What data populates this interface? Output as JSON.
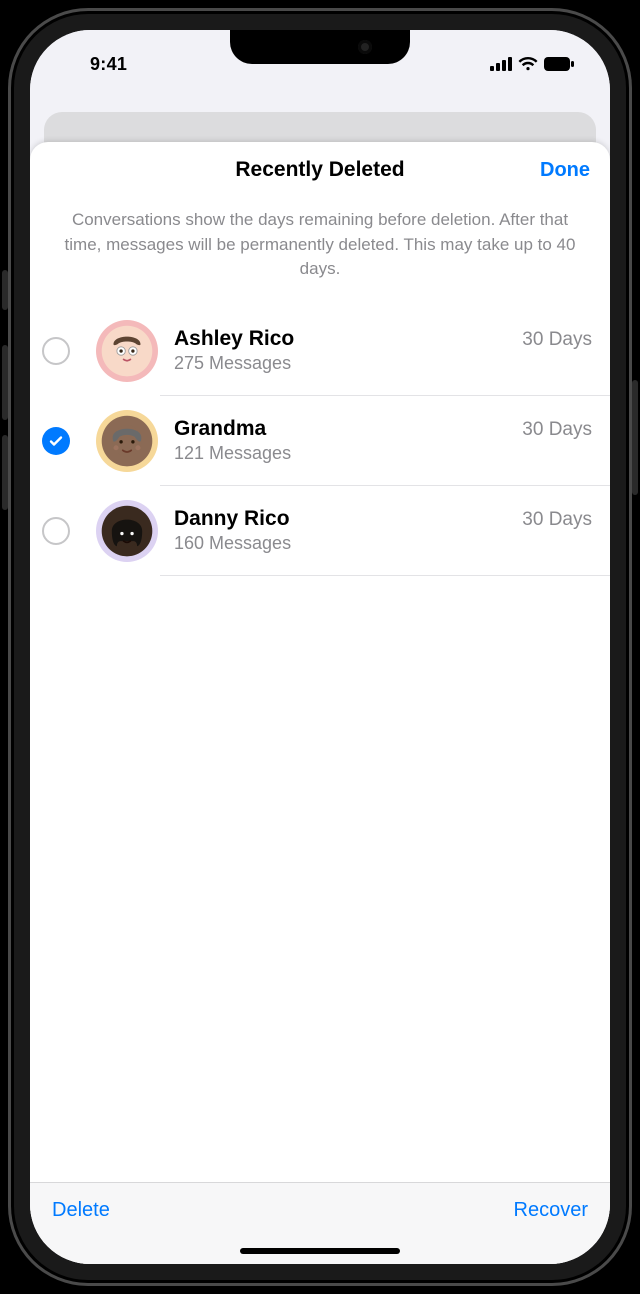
{
  "status": {
    "time": "9:41"
  },
  "nav": {
    "title": "Recently Deleted",
    "done": "Done"
  },
  "info": "Conversations show the days remaining before deletion. After that time, messages will be permanently deleted. This may take up to 40 days.",
  "rows": [
    {
      "name": "Ashley Rico",
      "messages": "275 Messages",
      "days": "30 Days",
      "selected": false,
      "avatar_bg": "#f4b9ba"
    },
    {
      "name": "Grandma",
      "messages": "121 Messages",
      "days": "30 Days",
      "selected": true,
      "avatar_bg": "#f6d899"
    },
    {
      "name": "Danny Rico",
      "messages": "160 Messages",
      "days": "30 Days",
      "selected": false,
      "avatar_bg": "#dcd2f2"
    }
  ],
  "toolbar": {
    "delete": "Delete",
    "recover": "Recover"
  }
}
